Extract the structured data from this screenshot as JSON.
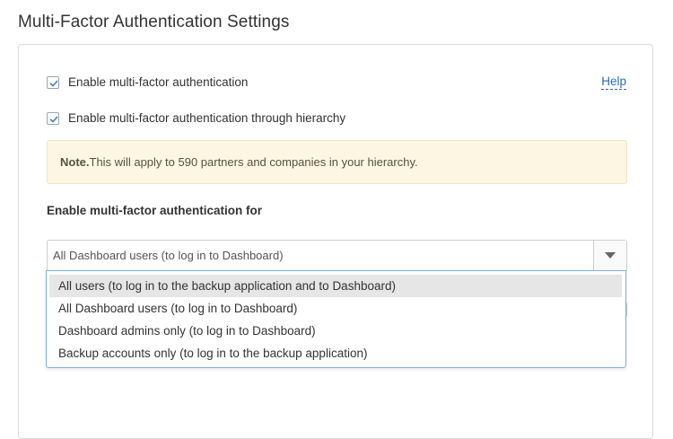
{
  "page": {
    "title": "Multi-Factor Authentication Settings"
  },
  "settings": {
    "enable_mfa": {
      "label": "Enable multi-factor authentication",
      "checked": true
    },
    "enable_mfa_hierarchy": {
      "label": "Enable multi-factor authentication through hierarchy",
      "checked": true
    },
    "help_link": "Help",
    "note": {
      "prefix": "Note.",
      "text": "This will apply to 590 partners and companies in your hierarchy."
    },
    "mfa_for": {
      "label": "Enable multi-factor authentication for",
      "selected_value": "All Dashboard users (to log in to Dashboard)",
      "dropdown_icon": "caret-down-icon",
      "options": [
        "All users (to log in to the backup application and to Dashboard)",
        "All Dashboard users (to log in to Dashboard)",
        "Dashboard admins only (to log in to Dashboard)",
        "Backup accounts only (to log in to the backup application)"
      ],
      "highlighted_option": "All users (to log in to the backup application and to Dashboard)"
    }
  },
  "colors": {
    "link": "#2b6cb0",
    "note_background": "#fdf6e3",
    "dropdown_border": "#7fb0dd",
    "option_highlight": "#e6e6e6",
    "checkmark": "#4a7fb5"
  }
}
